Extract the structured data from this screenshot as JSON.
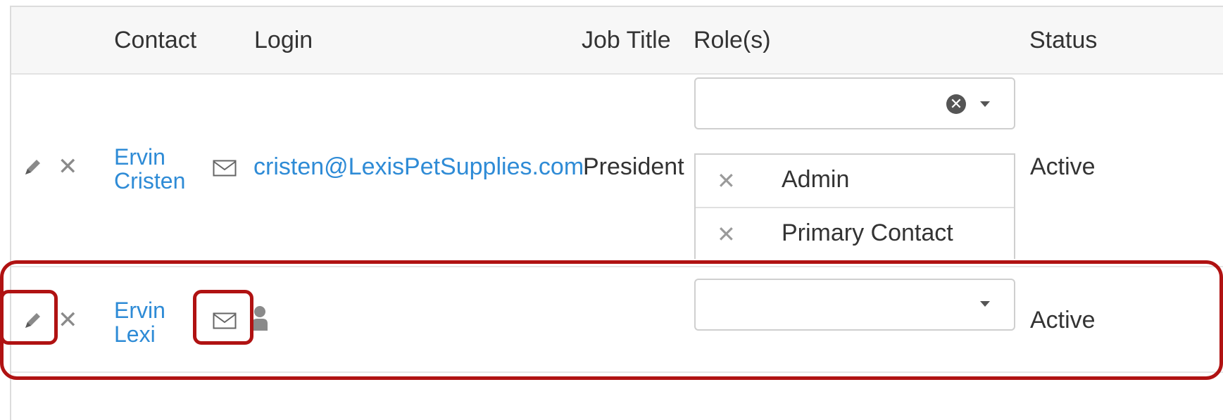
{
  "columns": {
    "contact": "Contact",
    "login": "Login",
    "job_title": "Job Title",
    "roles": "Role(s)",
    "status": "Status"
  },
  "rows": [
    {
      "name_first": "Ervin",
      "name_last": "Cristen",
      "login_email": "cristen@LexisPetSupplies.com",
      "job_title": "President",
      "roles_selected": [
        "Admin",
        "Primary Contact"
      ],
      "status": "Active"
    },
    {
      "name_first": "Ervin",
      "name_last": "Lexi",
      "login_email": "",
      "job_title": "",
      "roles_selected": [],
      "status": "Active"
    }
  ],
  "icons": {
    "edit": "pencil-icon",
    "delete": "close-icon",
    "email": "envelope-icon",
    "user": "user-icon",
    "clear": "clear-circle-icon",
    "dropdown": "caret-down-icon"
  },
  "colors": {
    "link": "#2e8bd6",
    "highlight": "#b01212",
    "header_bg": "#f7f7f7"
  }
}
